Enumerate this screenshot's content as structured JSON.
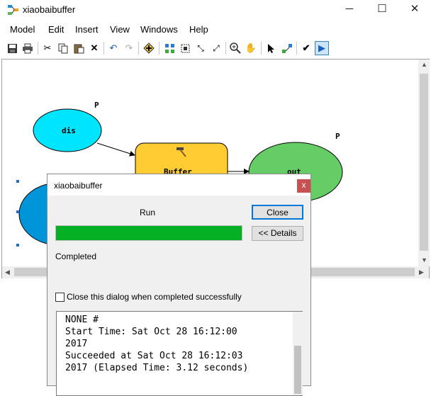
{
  "window": {
    "title": "xiaobaibuffer",
    "app_icon": "model-builder-icon",
    "minimize": "─",
    "maximize": "☐",
    "close": "✕"
  },
  "menu": [
    "Model",
    "Edit",
    "Insert",
    "View",
    "Windows",
    "Help"
  ],
  "toolbar": {
    "icons": [
      "save-icon",
      "print-icon",
      "cut-icon",
      "copy-icon",
      "paste-icon",
      "delete-icon",
      "undo-icon",
      "redo-icon",
      "add-data-icon",
      "auto-layout-icon",
      "full-extent-icon",
      "zoom-in-fixed-icon",
      "zoom-out-fixed-icon",
      "zoom-in-icon",
      "pan-icon",
      "select-icon",
      "connect-icon",
      "validate-icon",
      "run-icon"
    ]
  },
  "model": {
    "nodes": [
      {
        "label": "dis",
        "param": "P",
        "color": "#00e5ff"
      },
      {
        "label": "Buffer",
        "color": "#ffcc33"
      },
      {
        "label": "out",
        "param": "P",
        "color": "#66cc66"
      },
      {
        "label": "",
        "color": "#0094d9"
      }
    ]
  },
  "dialog": {
    "title": "xiaobaibuffer",
    "close_glyph": "x",
    "run_label": "Run",
    "close_button": "Close",
    "details_button": "<< Details",
    "progress_percent": 100,
    "progress_color": "#06b025",
    "status": "Completed",
    "checkbox_label": "Close this dialog when completed successfully",
    "checkbox_checked": false,
    "log_lines": [
      "NONE #",
      "Start Time: Sat Oct 28 16:12:00",
      "2017",
      "Succeeded at Sat Oct 28 16:12:03",
      "2017 (Elapsed Time: 3.12 seconds)"
    ]
  }
}
